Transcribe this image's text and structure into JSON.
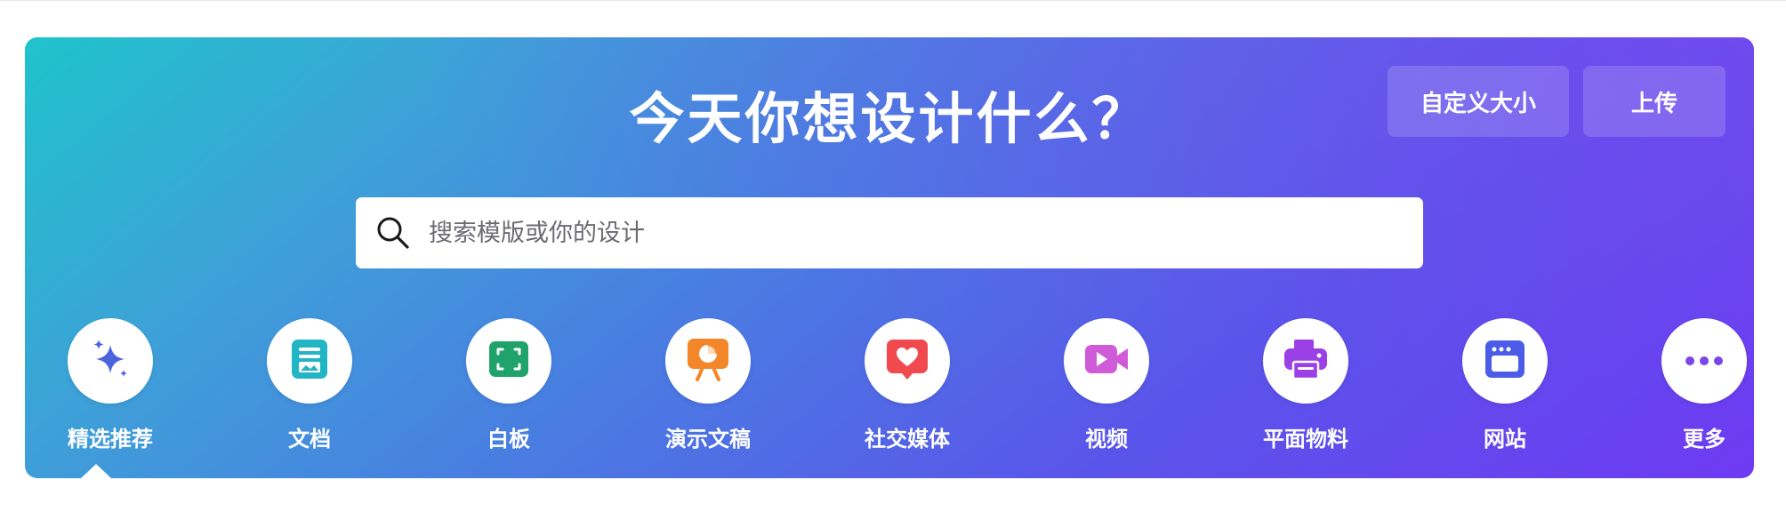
{
  "hero": {
    "title": "今天你想设计什么？",
    "custom_size_label": "自定义大小",
    "upload_label": "上传"
  },
  "search": {
    "placeholder": "搜索模版或你的设计",
    "value": ""
  },
  "categories": [
    {
      "label": "精选推荐",
      "icon": "sparkle-icon",
      "color": "#4b63e0",
      "active": true
    },
    {
      "label": "文档",
      "icon": "document-icon",
      "color": "#21b5c6"
    },
    {
      "label": "白板",
      "icon": "whiteboard-icon",
      "color": "#1fa36b"
    },
    {
      "label": "演示文稿",
      "icon": "presentation-icon",
      "color": "#f4862a"
    },
    {
      "label": "社交媒体",
      "icon": "social-heart-icon",
      "color": "#f04a4f"
    },
    {
      "label": "视频",
      "icon": "video-icon",
      "color": "#d05bd8"
    },
    {
      "label": "平面物料",
      "icon": "printer-icon",
      "color": "#9b3fe6"
    },
    {
      "label": "网站",
      "icon": "website-icon",
      "color": "#4d5ce8"
    },
    {
      "label": "更多",
      "icon": "more-icon",
      "color": "#7a46e8"
    }
  ]
}
